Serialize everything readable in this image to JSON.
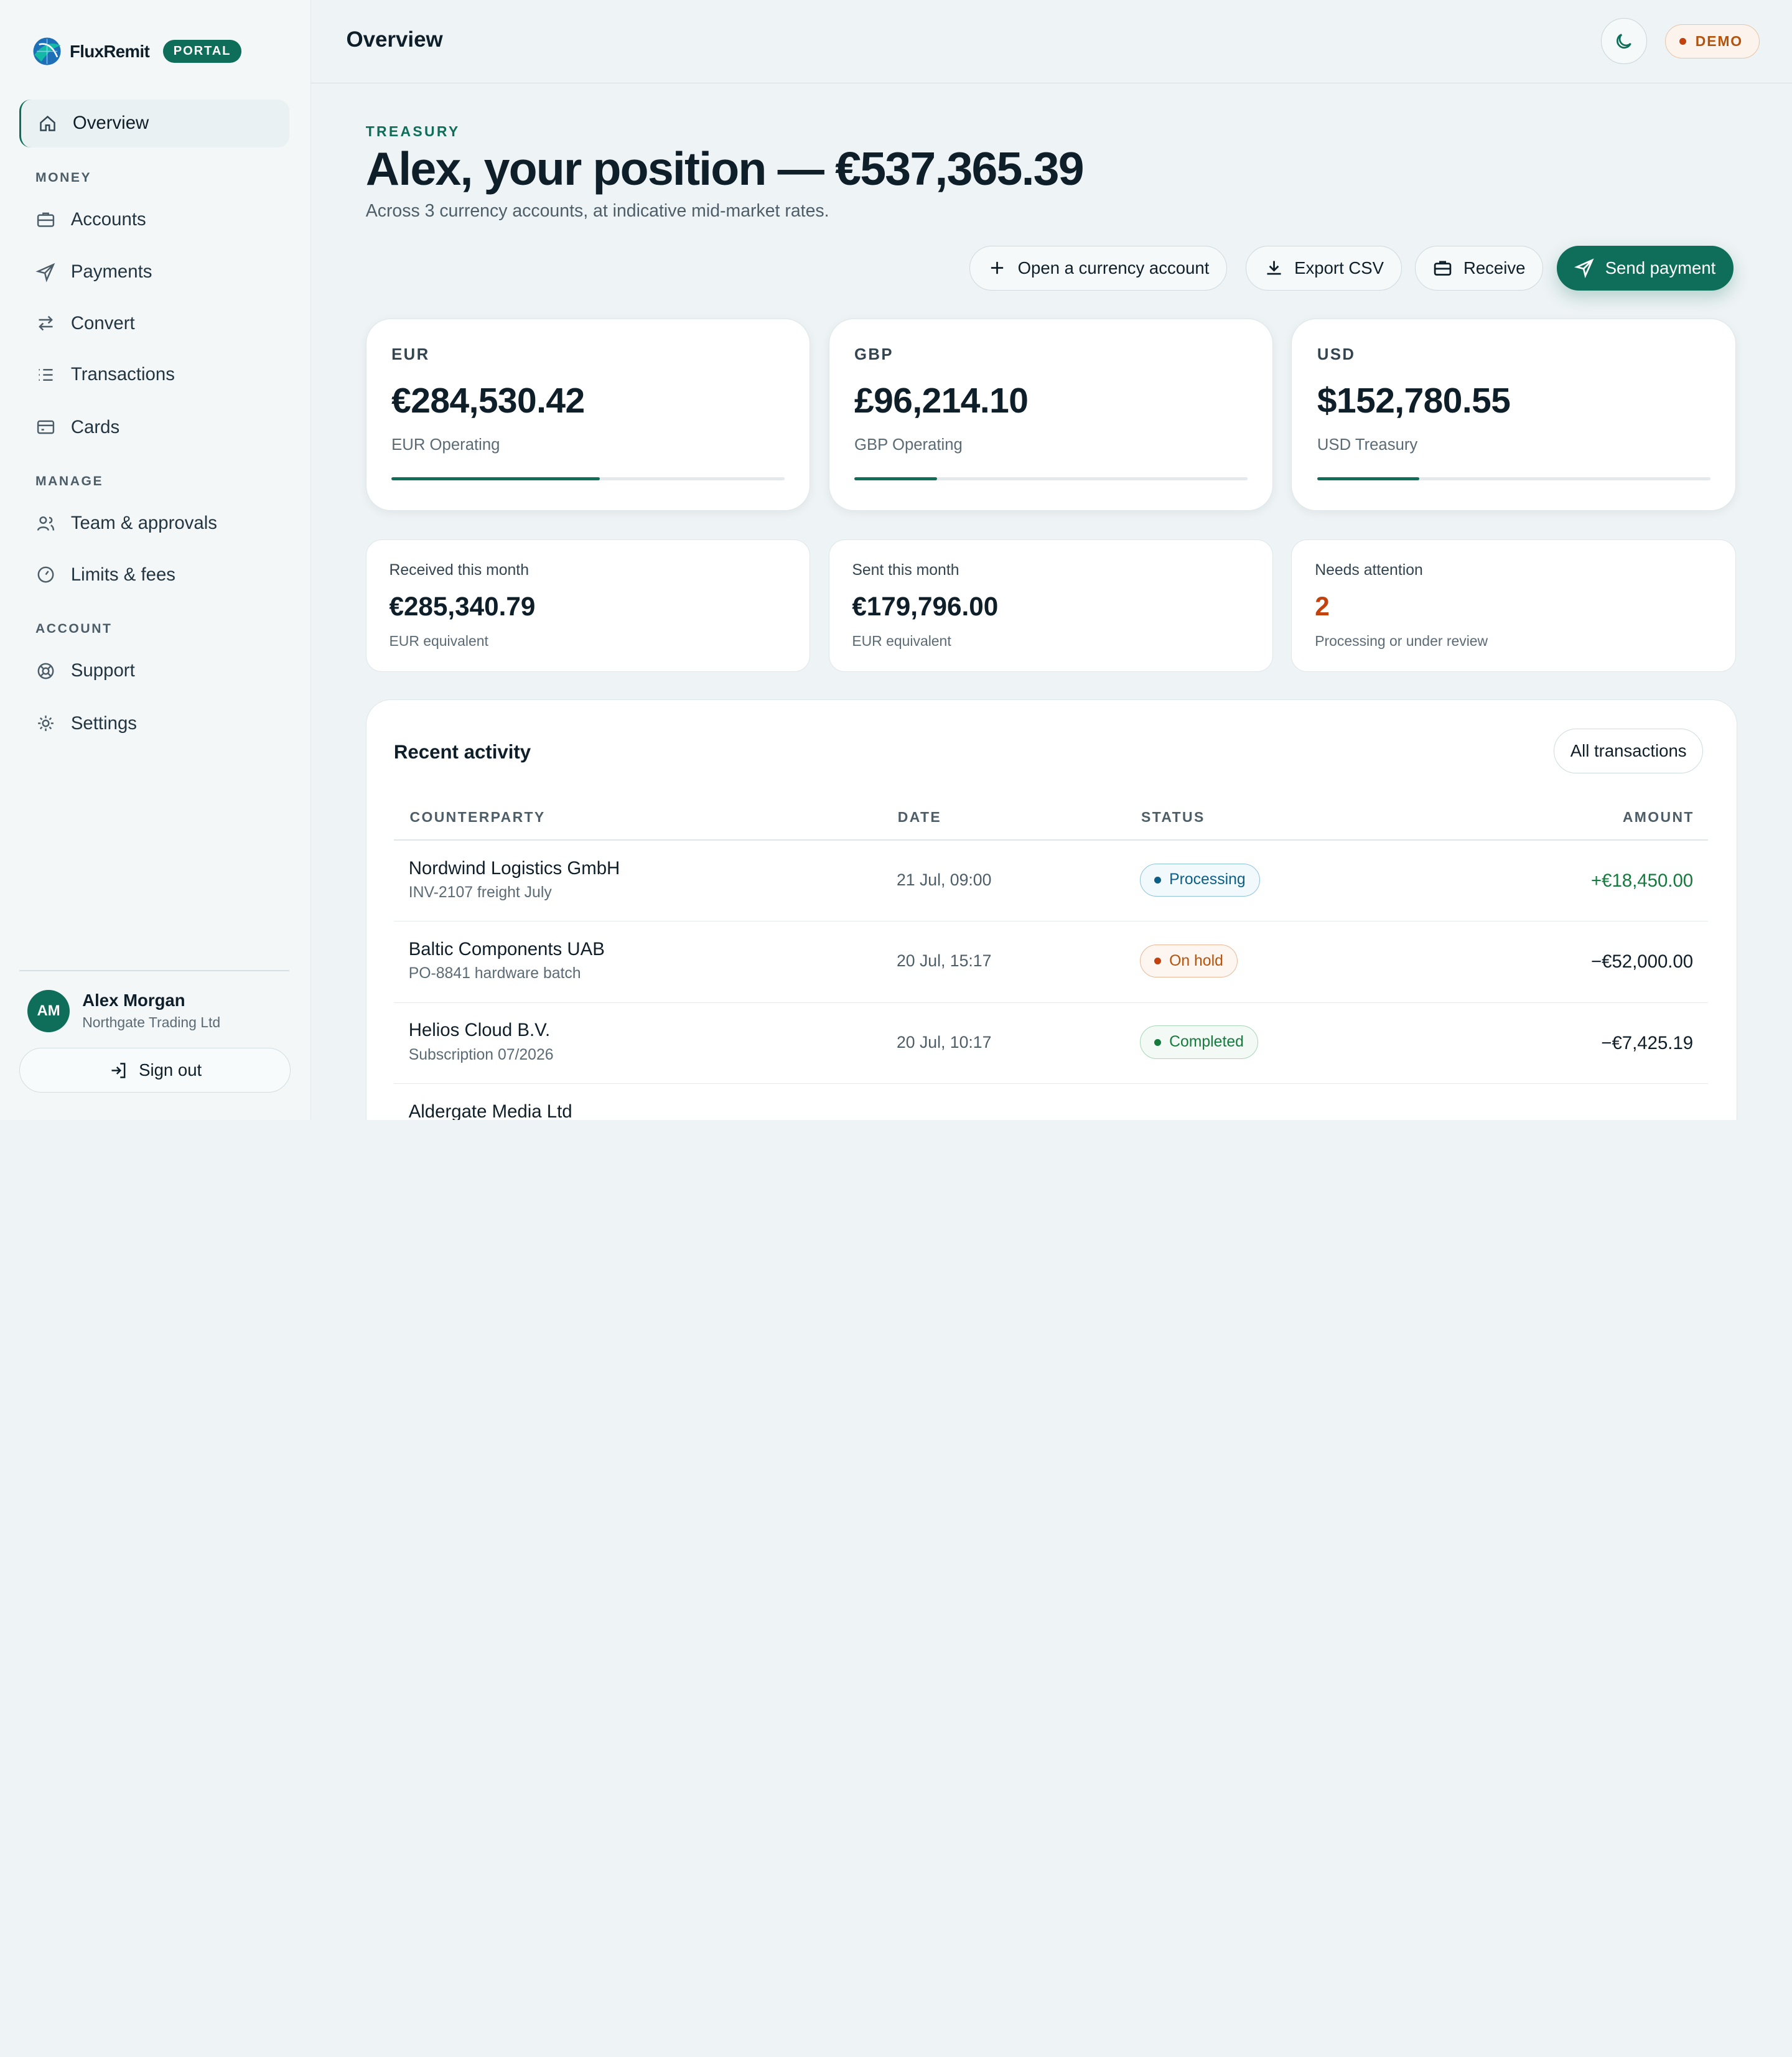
{
  "brand": {
    "name": "FluxRemit",
    "badge": "PORTAL"
  },
  "header": {
    "title": "Overview",
    "demo_label": "DEMO"
  },
  "sidebar": {
    "overview": {
      "label": "Overview",
      "icon": "home-icon"
    },
    "sections": [
      {
        "label": "MONEY",
        "items": [
          {
            "label": "Accounts",
            "icon": "briefcase-icon"
          },
          {
            "label": "Payments",
            "icon": "send-icon"
          },
          {
            "label": "Convert",
            "icon": "swap-icon"
          },
          {
            "label": "Transactions",
            "icon": "list-icon"
          },
          {
            "label": "Cards",
            "icon": "card-icon"
          }
        ]
      },
      {
        "label": "MANAGE",
        "items": [
          {
            "label": "Team & approvals",
            "icon": "users-icon"
          },
          {
            "label": "Limits & fees",
            "icon": "gauge-icon"
          }
        ]
      },
      {
        "label": "ACCOUNT",
        "items": [
          {
            "label": "Support",
            "icon": "lifebuoy-icon"
          },
          {
            "label": "Settings",
            "icon": "sun-gear-icon"
          }
        ]
      }
    ],
    "user": {
      "initials": "AM",
      "name": "Alex Morgan",
      "org": "Northgate Trading Ltd"
    },
    "signout_label": "Sign out"
  },
  "hero": {
    "eyebrow": "TREASURY",
    "headline": "Alex, your position — €537,365.39",
    "subtitle": "Across 3 currency accounts, at indicative mid-market rates."
  },
  "actions": {
    "open_account": "Open a currency account",
    "export_csv": "Export CSV",
    "receive": "Receive",
    "send_payment": "Send payment"
  },
  "balances": [
    {
      "currency": "EUR",
      "amount": "€284,530.42",
      "account": "EUR Operating",
      "share": 0.53
    },
    {
      "currency": "GBP",
      "amount": "£96,214.10",
      "account": "GBP Operating",
      "share": 0.21
    },
    {
      "currency": "USD",
      "amount": "$152,780.55",
      "account": "USD Treasury",
      "share": 0.26
    }
  ],
  "stats": [
    {
      "label": "Received this month",
      "value": "€285,340.79",
      "note": "EUR equivalent"
    },
    {
      "label": "Sent this month",
      "value": "€179,796.00",
      "note": "EUR equivalent"
    },
    {
      "label": "Needs attention",
      "value": "2",
      "note": "Processing or under review"
    }
  ],
  "activity": {
    "title": "Recent activity",
    "all_label": "All transactions",
    "columns": [
      "COUNTERPARTY",
      "DATE",
      "STATUS",
      "AMOUNT"
    ],
    "rows": [
      {
        "counterparty": "Nordwind Logistics GmbH",
        "ref": "INV-2107 freight July",
        "date": "21 Jul, 09:00",
        "status": "Processing",
        "amount": "+€18,450.00"
      },
      {
        "counterparty": "Baltic Components UAB",
        "ref": "PO-8841 hardware batch",
        "date": "20 Jul, 15:17",
        "status": "On hold",
        "amount": "−€52,000.00"
      },
      {
        "counterparty": "Helios Cloud B.V.",
        "ref": "Subscription 07/2026",
        "date": "20 Jul, 10:17",
        "status": "Completed",
        "amount": "−€7,425.19"
      },
      {
        "counterparty": "Aldergate Media Ltd",
        "ref": "",
        "date": "",
        "status": "",
        "amount": ""
      }
    ]
  },
  "colors": {
    "accent": "#0e6e5a",
    "warn": "#c2410c",
    "positive": "#157a3e",
    "info": "#0b5f86"
  }
}
